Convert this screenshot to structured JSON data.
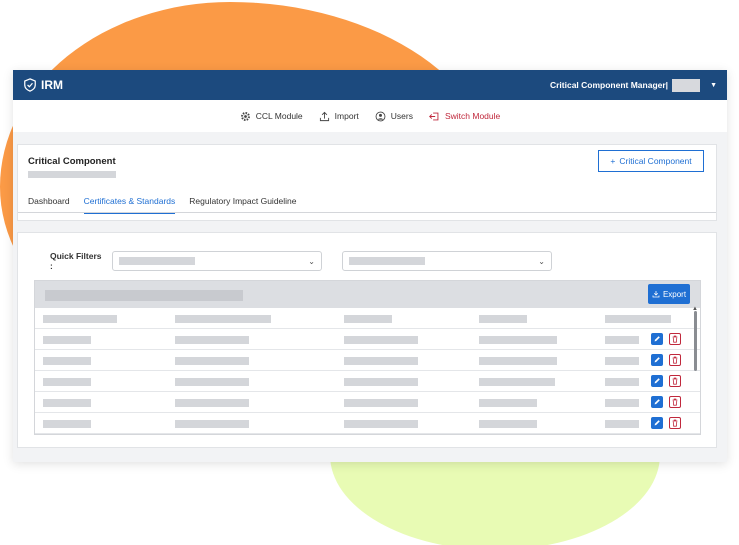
{
  "app": {
    "name": "IRM"
  },
  "user": {
    "role_label": "Critical Component Manager|"
  },
  "modules": [
    {
      "label": "CCL Module",
      "icon": "gear-icon"
    },
    {
      "label": "Import",
      "icon": "upload-icon"
    },
    {
      "label": "Users",
      "icon": "user-icon"
    },
    {
      "label": "Switch Module",
      "icon": "switch-icon"
    }
  ],
  "page": {
    "title": "Critical Component",
    "add_button": "Critical Component",
    "tabs": [
      "Dashboard",
      "Certificates & Standards",
      "Regulatory Impact Guideline"
    ],
    "active_tab": 1
  },
  "filters": {
    "label": "Quick Filters :"
  },
  "table": {
    "export_label": "Export"
  },
  "colors": {
    "header": "#1c4a7e",
    "accent": "#1f6fd3",
    "danger": "#c0283c"
  }
}
